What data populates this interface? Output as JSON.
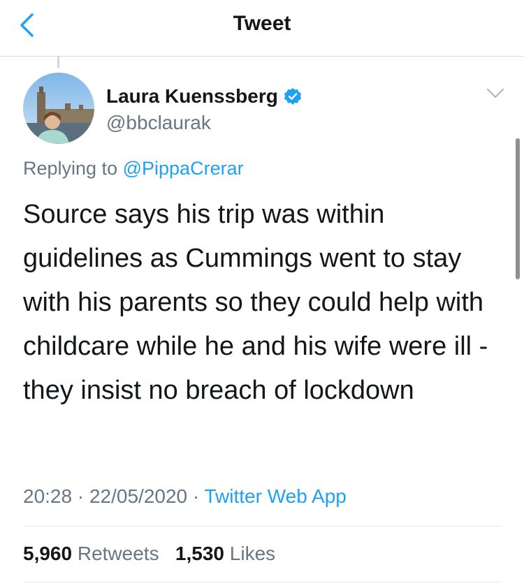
{
  "nav": {
    "title": "Tweet",
    "back_icon": "chevron-left-icon"
  },
  "author": {
    "name": "Laura Kuenssberg",
    "handle": "@bbclaurak",
    "verified_icon": "verified-badge-icon"
  },
  "reply": {
    "prefix": "Replying to",
    "mention": "@PippaCrerar"
  },
  "tweet": {
    "text": "Source says his trip was within guidelines as Cummings went to stay with his parents so they could help with childcare while he and his wife were ill - they insist no breach of lockdown"
  },
  "meta": {
    "time": "20:28",
    "date": "22/05/2020",
    "separator": "·",
    "source": "Twitter Web App"
  },
  "stats": {
    "retweets_count": "5,960",
    "retweets_label": "Retweets",
    "likes_count": "1,530",
    "likes_label": "Likes"
  },
  "colors": {
    "accent": "#1da1f2",
    "text": "#14171a",
    "secondary": "#657786"
  }
}
